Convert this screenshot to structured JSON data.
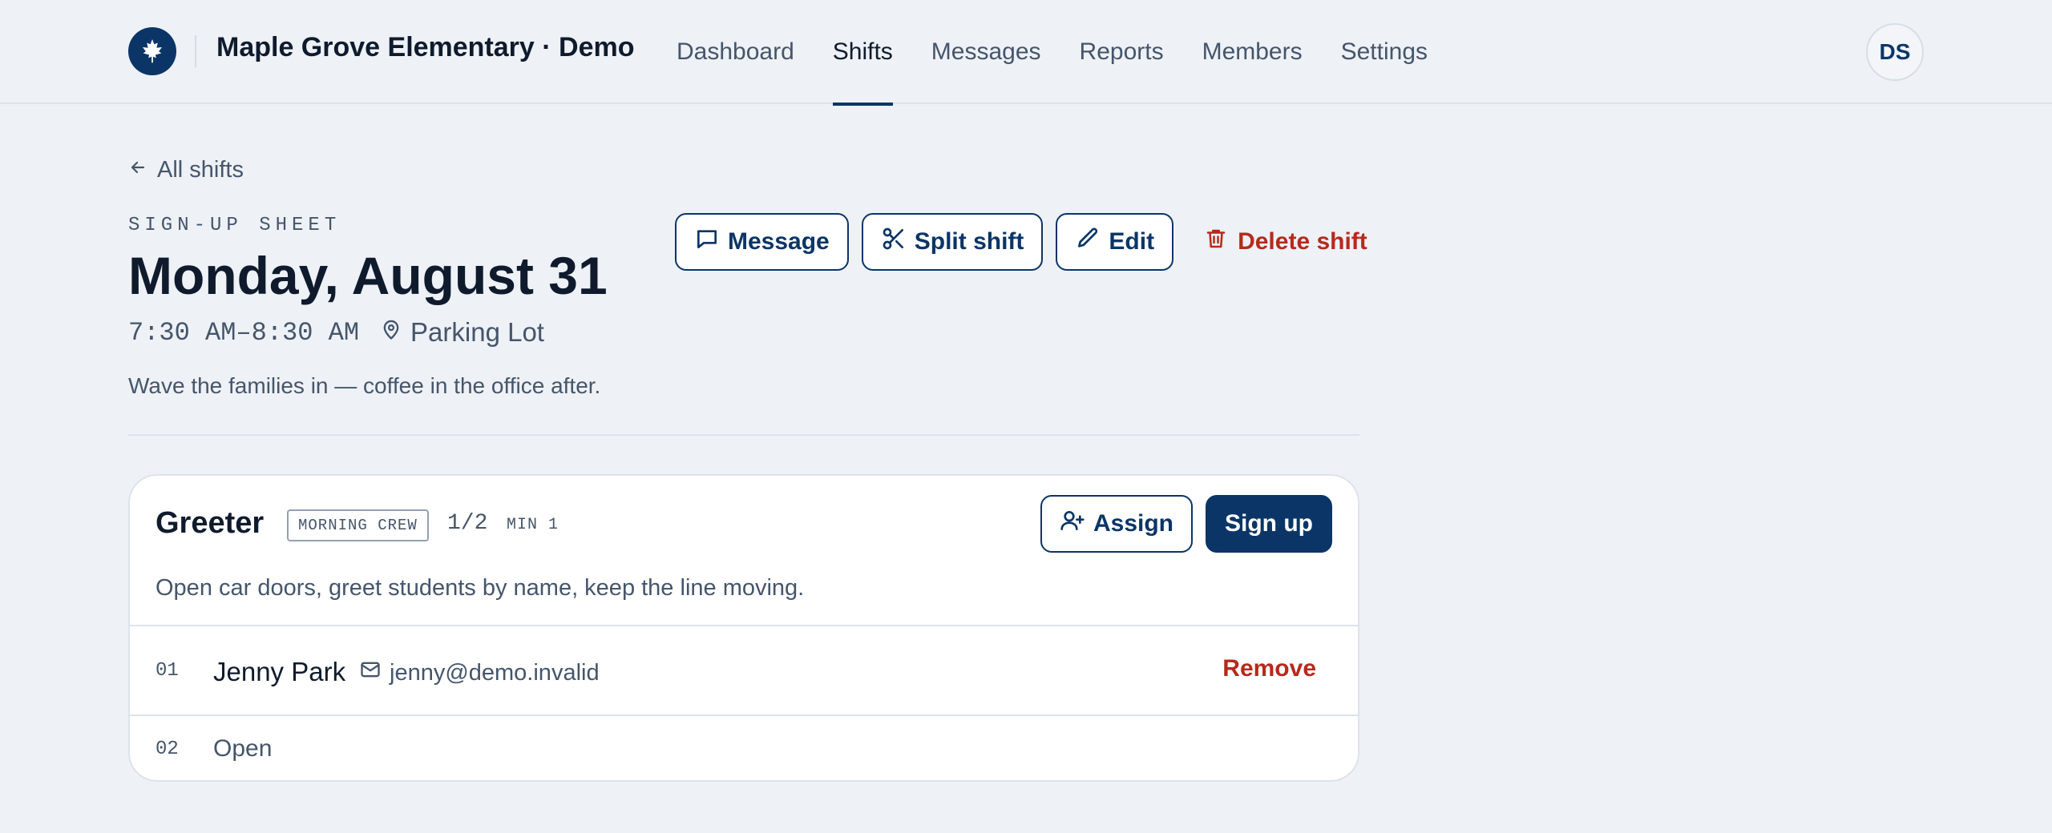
{
  "header": {
    "brand": "Maple Grove Elementary · Demo",
    "nav": [
      {
        "label": "Dashboard",
        "active": false
      },
      {
        "label": "Shifts",
        "active": true
      },
      {
        "label": "Messages",
        "active": false
      },
      {
        "label": "Reports",
        "active": false
      },
      {
        "label": "Members",
        "active": false
      },
      {
        "label": "Settings",
        "active": false
      }
    ],
    "avatar_initials": "DS"
  },
  "page": {
    "back_label": "All shifts",
    "eyebrow": "SIGN-UP SHEET",
    "title": "Monday, August 31",
    "time": "7:30 AM–8:30 AM",
    "location": "Parking Lot",
    "description": "Wave the families in — coffee in the office after."
  },
  "actions": {
    "message": "Message",
    "split": "Split shift",
    "edit": "Edit",
    "delete": "Delete shift"
  },
  "role": {
    "name": "Greeter",
    "tag": "MORNING CREW",
    "count": "1/2",
    "min": "MIN 1",
    "assign_label": "Assign",
    "signup_label": "Sign up",
    "description": "Open car doors, greet students by name, keep the line moving.",
    "slots": [
      {
        "num": "01",
        "name": "Jenny Park",
        "email": "jenny@demo.invalid",
        "action": "Remove"
      },
      {
        "num": "02",
        "status": "Open"
      }
    ]
  },
  "colors": {
    "primary": "#0b3566",
    "danger": "#b52a1c",
    "background": "#eef1f6",
    "muted_text": "#45556b"
  },
  "icons": {
    "logo": "maple-leaf-icon",
    "back": "arrow-left-icon",
    "location": "map-pin-icon",
    "message": "message-square-icon",
    "split": "scissors-icon",
    "edit": "pencil-icon",
    "delete": "trash-icon",
    "assign": "user-plus-icon",
    "email": "mail-icon"
  }
}
